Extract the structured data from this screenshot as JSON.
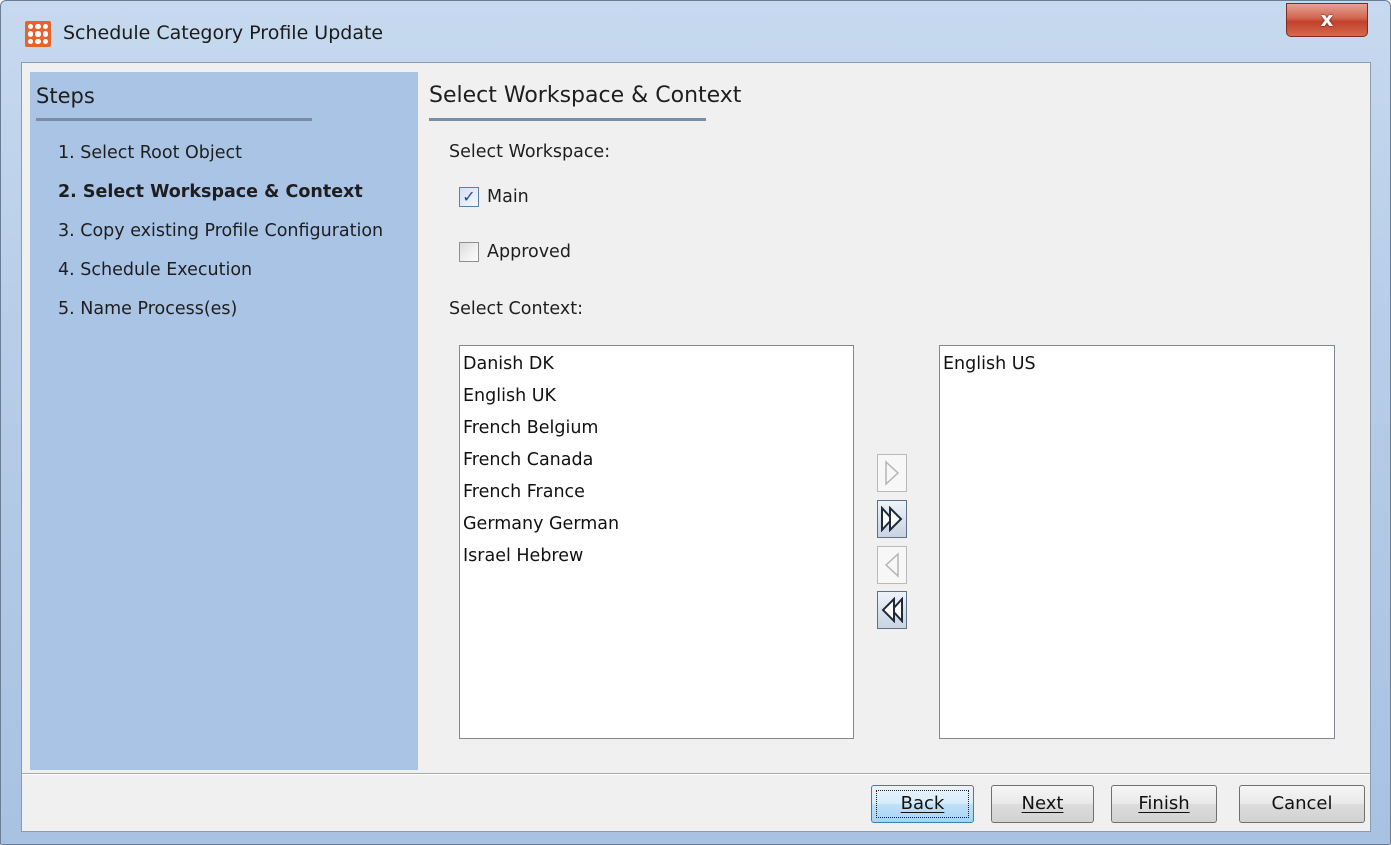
{
  "window": {
    "title": "Schedule Category Profile Update",
    "close_label": "x"
  },
  "steps": {
    "heading": "Steps",
    "items": [
      {
        "label": "1. Select Root Object",
        "active": false
      },
      {
        "label": "2. Select Workspace & Context",
        "active": true
      },
      {
        "label": "3. Copy existing Profile Configuration",
        "active": false
      },
      {
        "label": "4. Schedule Execution",
        "active": false
      },
      {
        "label": "5. Name Process(es)",
        "active": false
      }
    ]
  },
  "main": {
    "title": "Select Workspace & Context",
    "workspace_label": "Select Workspace:",
    "workspaces": [
      {
        "label": "Main",
        "checked": true
      },
      {
        "label": "Approved",
        "checked": false
      }
    ],
    "context_label": "Select Context:",
    "available_contexts": [
      "Danish DK",
      "English UK",
      "French Belgium",
      "French Canada",
      "French France",
      "Germany German",
      "Israel Hebrew"
    ],
    "selected_contexts": [
      "English US"
    ],
    "transfer_buttons": [
      {
        "icon": "move-right-icon",
        "enabled": false
      },
      {
        "icon": "move-all-right-icon",
        "enabled": true
      },
      {
        "icon": "move-left-icon",
        "enabled": false
      },
      {
        "icon": "move-all-left-icon",
        "enabled": true
      }
    ]
  },
  "footer": {
    "back_label": "Back",
    "next_label": "Next",
    "finish_label": "Finish",
    "cancel_label": "Cancel"
  }
}
